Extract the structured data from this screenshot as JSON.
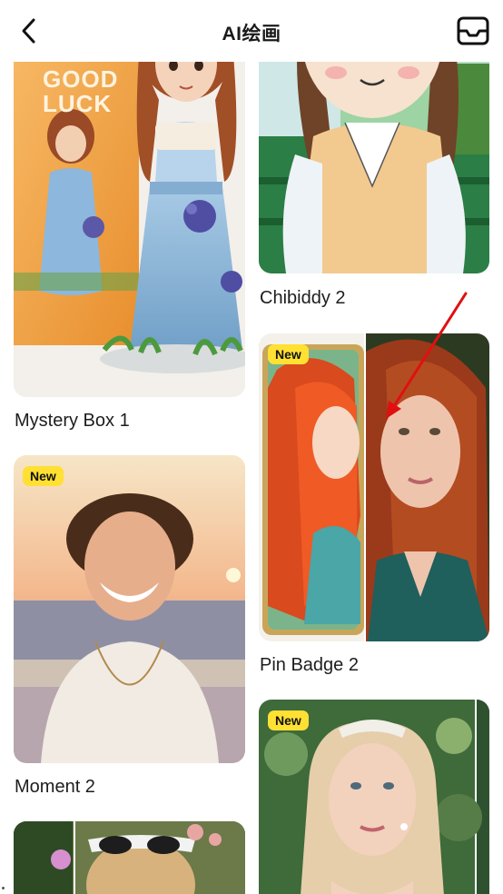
{
  "header": {
    "title": "AI绘画",
    "back_icon": "chevron-left-icon",
    "inbox_icon": "inbox-tray-icon"
  },
  "badges": {
    "new": "New"
  },
  "box_art": {
    "line1": "GOOD",
    "line2": "LUCK"
  },
  "cards": [
    {
      "label": "Mystery Box 1",
      "is_new": false
    },
    {
      "label": "Moment 2",
      "is_new": true
    },
    {
      "label": "Chibiddy 2",
      "is_new": false
    },
    {
      "label": "Pin Badge 2",
      "is_new": true
    },
    {
      "label": "",
      "is_new": false
    },
    {
      "label": "",
      "is_new": true
    }
  ],
  "colors": {
    "badge": "#ffe033",
    "annotation_arrow": "#e01010"
  }
}
